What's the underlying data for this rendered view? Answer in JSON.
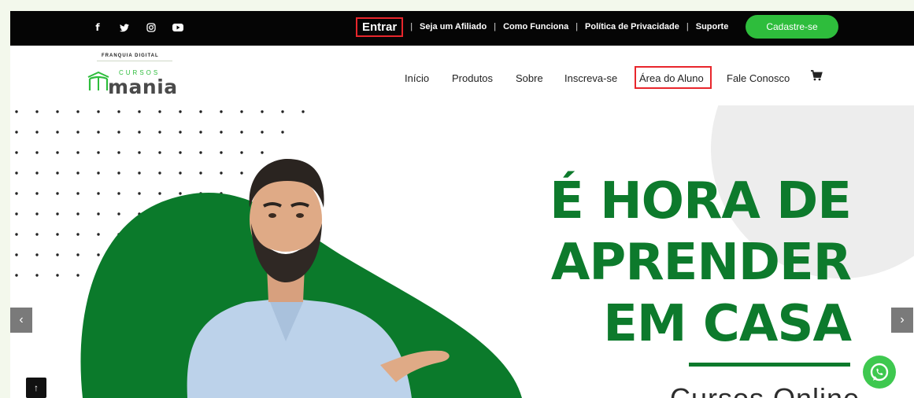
{
  "topbar": {
    "social_icons": [
      "facebook-icon",
      "twitter-icon",
      "instagram-icon",
      "youtube-icon"
    ],
    "entrar": "Entrar",
    "links": [
      "Seja um Afiliado",
      "Como Funciona",
      "Política de Privacidade",
      "Suporte"
    ],
    "separator": "|",
    "cadastre": "Cadastre-se"
  },
  "logo": {
    "tagline": "FRANQUIA DIGITAL",
    "cursos": "CURSOS",
    "mania": "mania"
  },
  "nav": {
    "items": [
      "Início",
      "Produtos",
      "Sobre",
      "Inscreva-se",
      "Área do Aluno",
      "Fale Conosco"
    ],
    "cart_icon": "cart-icon"
  },
  "hero": {
    "headline_lines": [
      "É HORA DE",
      "APRENDER",
      "EM CASA"
    ],
    "subheadline": "Cursos Online",
    "prev_arrow": "‹",
    "next_arrow": "›",
    "scroll_top": "↑"
  },
  "colors": {
    "brand_green": "#0d7a2c",
    "button_green": "#2ebd3c",
    "highlight_red": "#e8262c",
    "topbar_bg": "#050505"
  }
}
